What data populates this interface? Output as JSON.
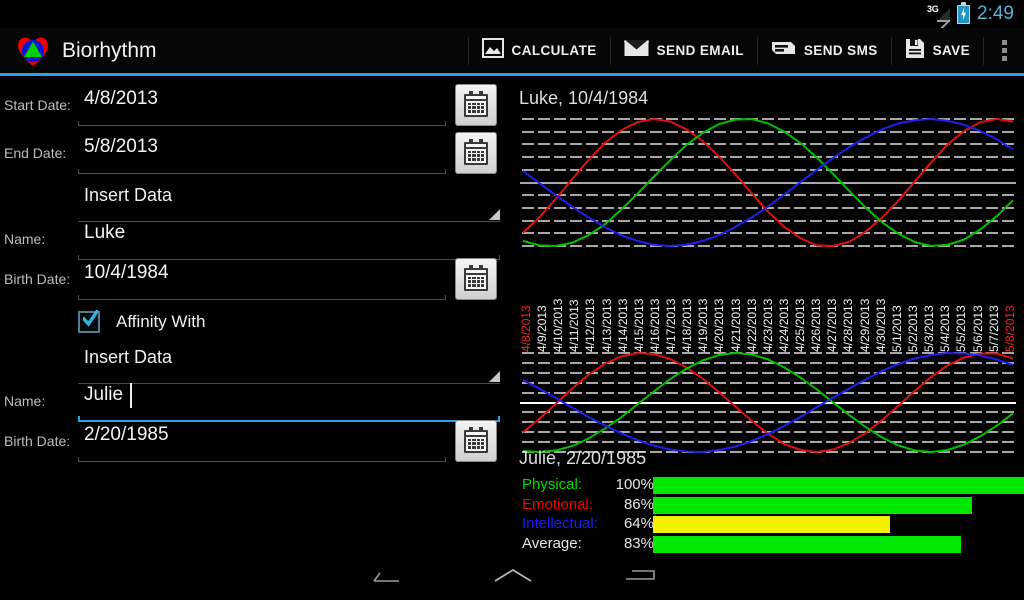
{
  "statusbar": {
    "network": "3G",
    "time": "2:49",
    "signal_icon": "signal-3g-icon",
    "battery_icon": "battery-charging-icon"
  },
  "actionbar": {
    "app_title": "Biorhythm",
    "logo_icon": "heart-triangle-logo",
    "actions": [
      {
        "label": "CALCULATE",
        "icon": "image-chart-icon"
      },
      {
        "label": "SEND EMAIL",
        "icon": "envelope-icon"
      },
      {
        "label": "SEND SMS",
        "icon": "sms-icon"
      },
      {
        "label": "SAVE",
        "icon": "floppy-disk-icon"
      }
    ],
    "overflow_icon": "overflow-menu-icon",
    "accent_color": "#27a5dd"
  },
  "form": {
    "start_date": {
      "label": "Start Date:",
      "value": "4/8/2013",
      "calendar_icon": "calendar-icon"
    },
    "end_date": {
      "label": "End Date:",
      "value": "5/8/2013",
      "calendar_icon": "calendar-icon"
    },
    "person1_spinner": {
      "value": "Insert Data"
    },
    "person1_name": {
      "label": "Name:",
      "value": "Luke"
    },
    "person1_birth": {
      "label": "Birth Date:",
      "value": "10/4/1984",
      "calendar_icon": "calendar-icon"
    },
    "affinity": {
      "label": "Affinity With",
      "checked": true
    },
    "person2_spinner": {
      "value": "Insert Data"
    },
    "person2_name": {
      "label": "Name:",
      "value": "Julie",
      "focused": true
    },
    "person2_birth": {
      "label": "Birth Date:",
      "value": "2/20/1985",
      "calendar_icon": "calendar-icon"
    }
  },
  "panel": {
    "chart1_title": "Luke, 10/4/1984",
    "chart2_title": "Julie, 2/20/1985",
    "dates": [
      "4/8/2013",
      "4/9/2013",
      "4/10/2013",
      "4/11/2013",
      "4/12/2013",
      "4/13/2013",
      "4/14/2013",
      "4/15/2013",
      "4/16/2013",
      "4/17/2013",
      "4/18/2013",
      "4/19/2013",
      "4/20/2013",
      "4/21/2013",
      "4/22/2013",
      "4/23/2013",
      "4/24/2013",
      "4/25/2013",
      "4/26/2013",
      "4/27/2013",
      "4/28/2013",
      "4/29/2013",
      "4/30/2013",
      "5/1/2013",
      "5/2/2013",
      "5/3/2013",
      "5/4/2013",
      "5/5/2013",
      "5/6/2013",
      "5/7/2013",
      "5/8/2013"
    ],
    "stats": [
      {
        "name": "Physical:",
        "pct": "100%",
        "value": 100,
        "label_color": "#00e000",
        "bar_color": "#00e800"
      },
      {
        "name": "Emotional:",
        "pct": "86%",
        "value": 86,
        "label_color": "#ef0000",
        "bar_color": "#00e800"
      },
      {
        "name": "Intellectual:",
        "pct": "64%",
        "value": 64,
        "label_color": "#1a1aff",
        "bar_color": "#f2f200"
      },
      {
        "name": "Average:",
        "pct": "83%",
        "value": 83,
        "label_color": "#e6e6e6",
        "bar_color": "#00e800"
      }
    ]
  },
  "chart_data": [
    {
      "type": "line",
      "title": "Luke, 10/4/1984",
      "xlabel": "",
      "ylabel": "",
      "x": [
        "4/8/2013",
        "4/9/2013",
        "4/10/2013",
        "4/11/2013",
        "4/12/2013",
        "4/13/2013",
        "4/14/2013",
        "4/15/2013",
        "4/16/2013",
        "4/17/2013",
        "4/18/2013",
        "4/19/2013",
        "4/20/2013",
        "4/21/2013",
        "4/22/2013",
        "4/23/2013",
        "4/24/2013",
        "4/25/2013",
        "4/26/2013",
        "4/27/2013",
        "4/28/2013",
        "4/29/2013",
        "4/30/2013",
        "5/1/2013",
        "5/2/2013",
        "5/3/2013",
        "5/4/2013",
        "5/5/2013",
        "5/6/2013",
        "5/7/2013",
        "5/8/2013"
      ],
      "ylim": [
        -100,
        100
      ],
      "grid": true,
      "series": [
        {
          "name": "Physical",
          "color": "#e01010",
          "period_days": 23,
          "phase_deg": 232,
          "values": [
            -79,
            -55,
            -26,
            5,
            35,
            62,
            82,
            95,
            100,
            96,
            84,
            65,
            41,
            13,
            -17,
            -46,
            -70,
            -88,
            -99,
            -100,
            -93,
            -77,
            -55,
            -28,
            2,
            32,
            60,
            81,
            95,
            100,
            96
          ]
        },
        {
          "name": "Emotional",
          "color": "#00c000",
          "period_days": 28,
          "phase_deg": 247,
          "values": [
            -92,
            -99,
            -100,
            -95,
            -83,
            -66,
            -43,
            -18,
            9,
            35,
            59,
            78,
            92,
            99,
            100,
            93,
            80,
            62,
            39,
            13,
            -14,
            -40,
            -63,
            -81,
            -94,
            -100,
            -98,
            -90,
            -74,
            -53,
            -28
          ]
        },
        {
          "name": "Intellectual",
          "color": "#2020ee",
          "period_days": 33,
          "phase_deg": 103,
          "values": [
            18,
            -1,
            -20,
            -38,
            -55,
            -70,
            -83,
            -92,
            -98,
            -100,
            -98,
            -92,
            -83,
            -70,
            -55,
            -38,
            -19,
            1,
            20,
            39,
            56,
            71,
            84,
            93,
            98,
            100,
            97,
            91,
            81,
            68,
            52
          ]
        }
      ]
    },
    {
      "type": "line",
      "title": "Julie, 2/20/1985",
      "xlabel": "",
      "ylabel": "",
      "x": [
        "4/8/2013",
        "4/9/2013",
        "4/10/2013",
        "4/11/2013",
        "4/12/2013",
        "4/13/2013",
        "4/14/2013",
        "4/15/2013",
        "4/16/2013",
        "4/17/2013",
        "4/18/2013",
        "4/19/2013",
        "4/20/2013",
        "4/21/2013",
        "4/22/2013",
        "4/23/2013",
        "4/24/2013",
        "4/25/2013",
        "4/26/2013",
        "4/27/2013",
        "4/28/2013",
        "4/29/2013",
        "4/30/2013",
        "5/1/2013",
        "5/2/2013",
        "5/3/2013",
        "5/4/2013",
        "5/5/2013",
        "5/6/2013",
        "5/7/2013",
        "5/8/2013"
      ],
      "ylim": [
        -100,
        100
      ],
      "grid": true,
      "series": [
        {
          "name": "Physical",
          "color": "#e01010",
          "period_days": 23,
          "phase_deg": 287,
          "values": [
            -60,
            -33,
            -3,
            28,
            56,
            78,
            93,
            100,
            98,
            88,
            71,
            48,
            21,
            -8,
            -37,
            -63,
            -84,
            -96,
            -100,
            -95,
            -81,
            -61,
            -35,
            -6,
            24,
            52,
            75,
            91,
            99,
            99,
            89
          ]
        },
        {
          "name": "Emotional",
          "color": "#00c000",
          "period_days": 28,
          "phase_deg": 258,
          "values": [
            -98,
            -100,
            -97,
            -88,
            -73,
            -53,
            -30,
            -4,
            22,
            47,
            68,
            85,
            96,
            100,
            97,
            87,
            71,
            50,
            26,
            0,
            -26,
            -50,
            -71,
            -87,
            -97,
            -100,
            -96,
            -85,
            -68,
            -47,
            -22
          ]
        },
        {
          "name": "Intellectual",
          "color": "#2020ee",
          "period_days": 33,
          "phase_deg": 83,
          "values": [
            45,
            28,
            9,
            -10,
            -29,
            -46,
            -62,
            -76,
            -87,
            -95,
            -99,
            -100,
            -96,
            -89,
            -78,
            -64,
            -47,
            -29,
            -9,
            10,
            29,
            47,
            64,
            78,
            89,
            96,
            100,
            99,
            95,
            87,
            76
          ]
        }
      ]
    }
  ],
  "navbar": {
    "back_icon": "back-arrow-icon",
    "home_icon": "home-icon",
    "recents_icon": "recent-apps-icon"
  }
}
